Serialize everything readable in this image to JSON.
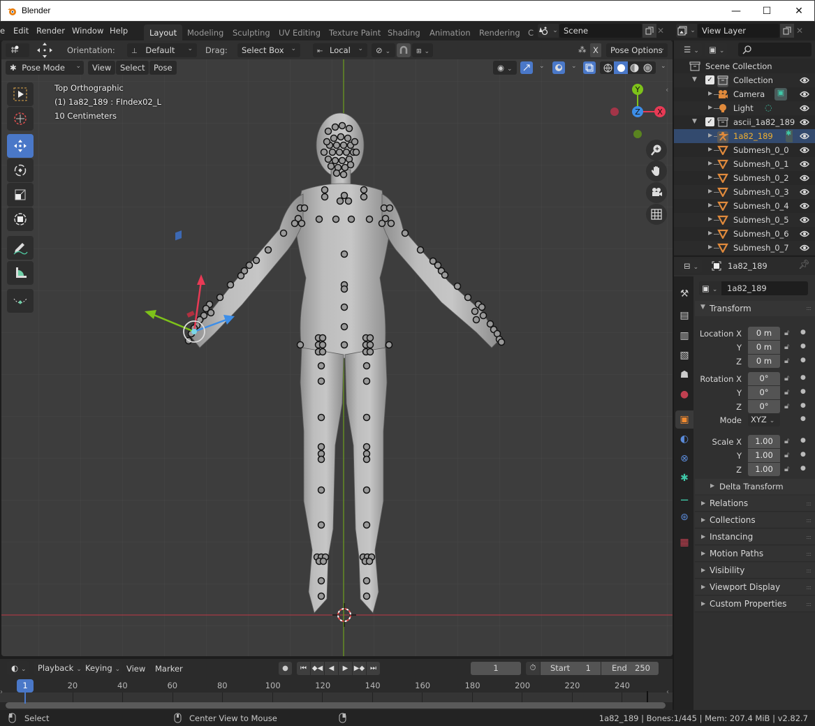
{
  "window": {
    "title": "Blender",
    "controls": {
      "minimize": "—",
      "maximize": "☐",
      "close": "✕"
    }
  },
  "menubar": {
    "items": [
      "e",
      "Edit",
      "Render",
      "Window",
      "Help"
    ],
    "workspace_tabs": [
      {
        "label": "Layout",
        "active": true
      },
      {
        "label": "Modeling",
        "active": false
      },
      {
        "label": "Sculpting",
        "active": false
      },
      {
        "label": "UV Editing",
        "active": false
      },
      {
        "label": "Texture Paint",
        "active": false
      },
      {
        "label": "Shading",
        "active": false
      },
      {
        "label": "Animation",
        "active": false
      },
      {
        "label": "Rendering",
        "active": false
      },
      {
        "label": "C",
        "active": false
      }
    ],
    "scene": "Scene",
    "view_layer": "View Layer"
  },
  "tool_header": {
    "orientation_label": "Orientation:",
    "orientation_value": "Default",
    "drag_label": "Drag:",
    "drag_value": "Select Box",
    "pivot_value": "Local",
    "mirror_x": "X",
    "pose_options": "Pose Options"
  },
  "viewport_header": {
    "mode": "Pose Mode",
    "menus": [
      "View",
      "Select",
      "Pose"
    ]
  },
  "viewport": {
    "view_name": "Top Orthographic",
    "active_info": "(1) 1a82_189 : FIndex02_L",
    "scale": "10 Centimeters",
    "gizmo": {
      "x": "X",
      "y": "Y",
      "z": "Z",
      "x_color": "#e83a55",
      "y_color": "#7ec21a",
      "z_color": "#3d8ee8"
    },
    "tools": [
      "select-box",
      "cursor",
      "move",
      "rotate",
      "scale",
      "transform",
      "annotate",
      "measure",
      "bone-roll"
    ],
    "active_tool": "move"
  },
  "outliner": {
    "search_placeholder": "",
    "root": "Scene Collection",
    "rows": [
      {
        "label": "Collection",
        "type": "collection",
        "depth": 1,
        "expanded": true,
        "checked": true
      },
      {
        "label": "Camera",
        "type": "camera",
        "depth": 2
      },
      {
        "label": "Light",
        "type": "light",
        "depth": 2
      },
      {
        "label": "ascii_1a82_189",
        "type": "collection",
        "depth": 1,
        "expanded": true,
        "checked": true
      },
      {
        "label": "1a82_189",
        "type": "armature",
        "depth": 2,
        "active": true
      },
      {
        "label": "Submesh_0_0",
        "type": "mesh",
        "depth": 2
      },
      {
        "label": "Submesh_0_1",
        "type": "mesh",
        "depth": 2
      },
      {
        "label": "Submesh_0_2",
        "type": "mesh",
        "depth": 2
      },
      {
        "label": "Submesh_0_3",
        "type": "mesh",
        "depth": 2
      },
      {
        "label": "Submesh_0_4",
        "type": "mesh",
        "depth": 2
      },
      {
        "label": "Submesh_0_5",
        "type": "mesh",
        "depth": 2
      },
      {
        "label": "Submesh_0_6",
        "type": "mesh",
        "depth": 2
      },
      {
        "label": "Submesh_0_7",
        "type": "mesh",
        "depth": 2
      }
    ]
  },
  "properties": {
    "header_object": "1a82_189",
    "object_name": "1a82_189",
    "transform_title": "Transform",
    "location": {
      "label": "Location X",
      "x": "0 m",
      "y": "0 m",
      "z": "0 m"
    },
    "rotation": {
      "label": "Rotation X",
      "x": "0°",
      "y": "0°",
      "z": "0°"
    },
    "mode_label": "Mode",
    "mode_value": "XYZ",
    "scale": {
      "label": "Scale X",
      "x": "1.00",
      "y": "1.00",
      "z": "1.00"
    },
    "axis_y": "Y",
    "axis_z": "Z",
    "delta_transform": "Delta Transform",
    "panels": [
      "Relations",
      "Collections",
      "Instancing",
      "Motion Paths",
      "Visibility",
      "Viewport Display",
      "Custom Properties"
    ]
  },
  "timeline": {
    "menus": [
      "Playback",
      "Keying",
      "View",
      "Marker"
    ],
    "current_frame": "1",
    "start_label": "Start",
    "start_value": "1",
    "end_label": "End",
    "end_value": "250",
    "ticks": [
      "20",
      "40",
      "60",
      "80",
      "100",
      "120",
      "140",
      "160",
      "180",
      "200",
      "220",
      "240"
    ],
    "playhead_label": "1"
  },
  "statusbar": {
    "left_action": "Select",
    "middle_action": "Center View to Mouse",
    "stats": "1a82_189 | Bones:1/445  | Mem: 207.4 MiB | v2.82.7"
  }
}
